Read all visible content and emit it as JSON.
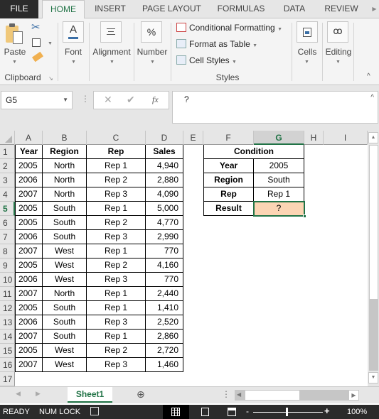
{
  "ribbon_tabs": [
    "FILE",
    "HOME",
    "INSERT",
    "PAGE LAYOUT",
    "FORMULAS",
    "DATA",
    "REVIEW"
  ],
  "active_tab": "HOME",
  "ribbon": {
    "clipboard": {
      "paste_label": "Paste",
      "group_label": "Clipboard"
    },
    "font_label": "Font",
    "alignment_label": "Alignment",
    "number_label": "Number",
    "styles": {
      "conditional_formatting": "Conditional Formatting",
      "format_as_table": "Format as Table",
      "cell_styles": "Cell Styles",
      "group_label": "Styles"
    },
    "cells_label": "Cells",
    "editing_label": "Editing"
  },
  "formula_bar": {
    "name_box": "G5",
    "formula": "?",
    "fx": "fx"
  },
  "columns": [
    "A",
    "B",
    "C",
    "D",
    "E",
    "F",
    "G",
    "H",
    "I"
  ],
  "selected_column": "G",
  "rows": [
    "1",
    "2",
    "3",
    "4",
    "5",
    "6",
    "7",
    "8",
    "9",
    "10",
    "11",
    "12",
    "13",
    "14",
    "15",
    "16",
    "17"
  ],
  "selected_row": "5",
  "table": {
    "headers": [
      "Year",
      "Region",
      "Rep",
      "Sales"
    ],
    "rows": [
      [
        "2005",
        "North",
        "Rep 1",
        "4,940"
      ],
      [
        "2006",
        "North",
        "Rep 2",
        "2,880"
      ],
      [
        "2007",
        "North",
        "Rep 3",
        "4,090"
      ],
      [
        "2005",
        "South",
        "Rep 1",
        "5,000"
      ],
      [
        "2005",
        "South",
        "Rep 2",
        "4,770"
      ],
      [
        "2006",
        "South",
        "Rep 3",
        "2,990"
      ],
      [
        "2007",
        "West",
        "Rep 1",
        "770"
      ],
      [
        "2005",
        "West",
        "Rep 2",
        "4,160"
      ],
      [
        "2006",
        "West",
        "Rep 3",
        "770"
      ],
      [
        "2007",
        "North",
        "Rep 1",
        "2,440"
      ],
      [
        "2005",
        "South",
        "Rep 1",
        "1,410"
      ],
      [
        "2006",
        "South",
        "Rep 3",
        "2,520"
      ],
      [
        "2007",
        "South",
        "Rep 1",
        "2,860"
      ],
      [
        "2005",
        "West",
        "Rep 2",
        "2,720"
      ],
      [
        "2007",
        "West",
        "Rep 3",
        "1,460"
      ]
    ]
  },
  "condition": {
    "title": "Condition",
    "rows": [
      [
        "Year",
        "2005"
      ],
      [
        "Region",
        "South"
      ],
      [
        "Rep",
        "Rep 1"
      ],
      [
        "Result",
        "?"
      ]
    ],
    "result_fill": "#fcd5b4"
  },
  "sheet_tabs": [
    "Sheet1"
  ],
  "status": {
    "ready": "READY",
    "num_lock": "NUM LOCK",
    "zoom": "100%"
  },
  "accent": "#217346"
}
